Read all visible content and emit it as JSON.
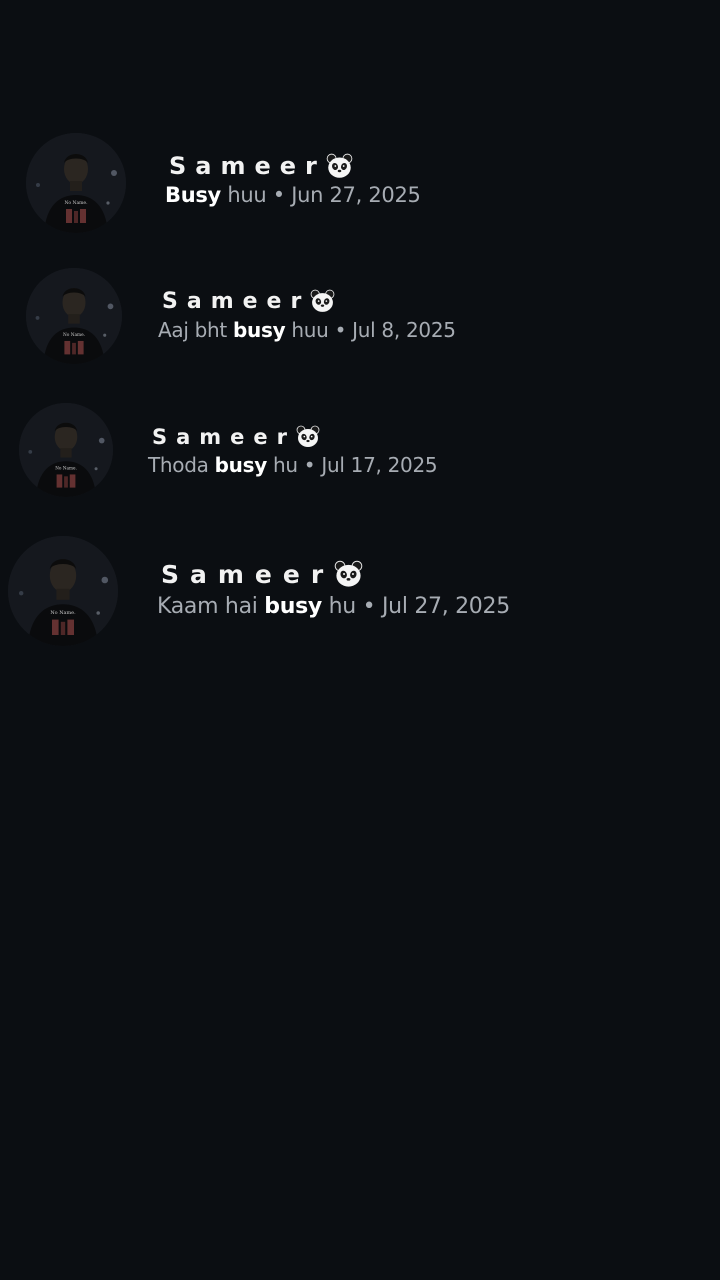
{
  "conversations": [
    {
      "name": "Sameer",
      "emoji_icon": "panda-face-icon",
      "message_before": "",
      "message_highlight": "Busy",
      "message_after": " huu",
      "separator": " • ",
      "date": "Jun 27, 2025"
    },
    {
      "name": "Sameer",
      "emoji_icon": "panda-face-icon",
      "message_before": "Aaj bht ",
      "message_highlight": "busy",
      "message_after": " huu",
      "separator": " • ",
      "date": "Jul 8, 2025"
    },
    {
      "name": "Sameer",
      "emoji_icon": "panda-face-icon",
      "message_before": "Thoda ",
      "message_highlight": "busy",
      "message_after": " hu",
      "separator": " • ",
      "date": "Jul 17, 2025"
    },
    {
      "name": "Sameer",
      "emoji_icon": "panda-face-icon",
      "message_before": "Kaam hai ",
      "message_highlight": "busy",
      "message_after": " hu",
      "separator": " • ",
      "date": "Jul 27, 2025"
    }
  ],
  "colors": {
    "background": "#0b0e12",
    "name": "#f2f2f2",
    "message": "#a7acb3",
    "highlight": "#ffffff"
  }
}
